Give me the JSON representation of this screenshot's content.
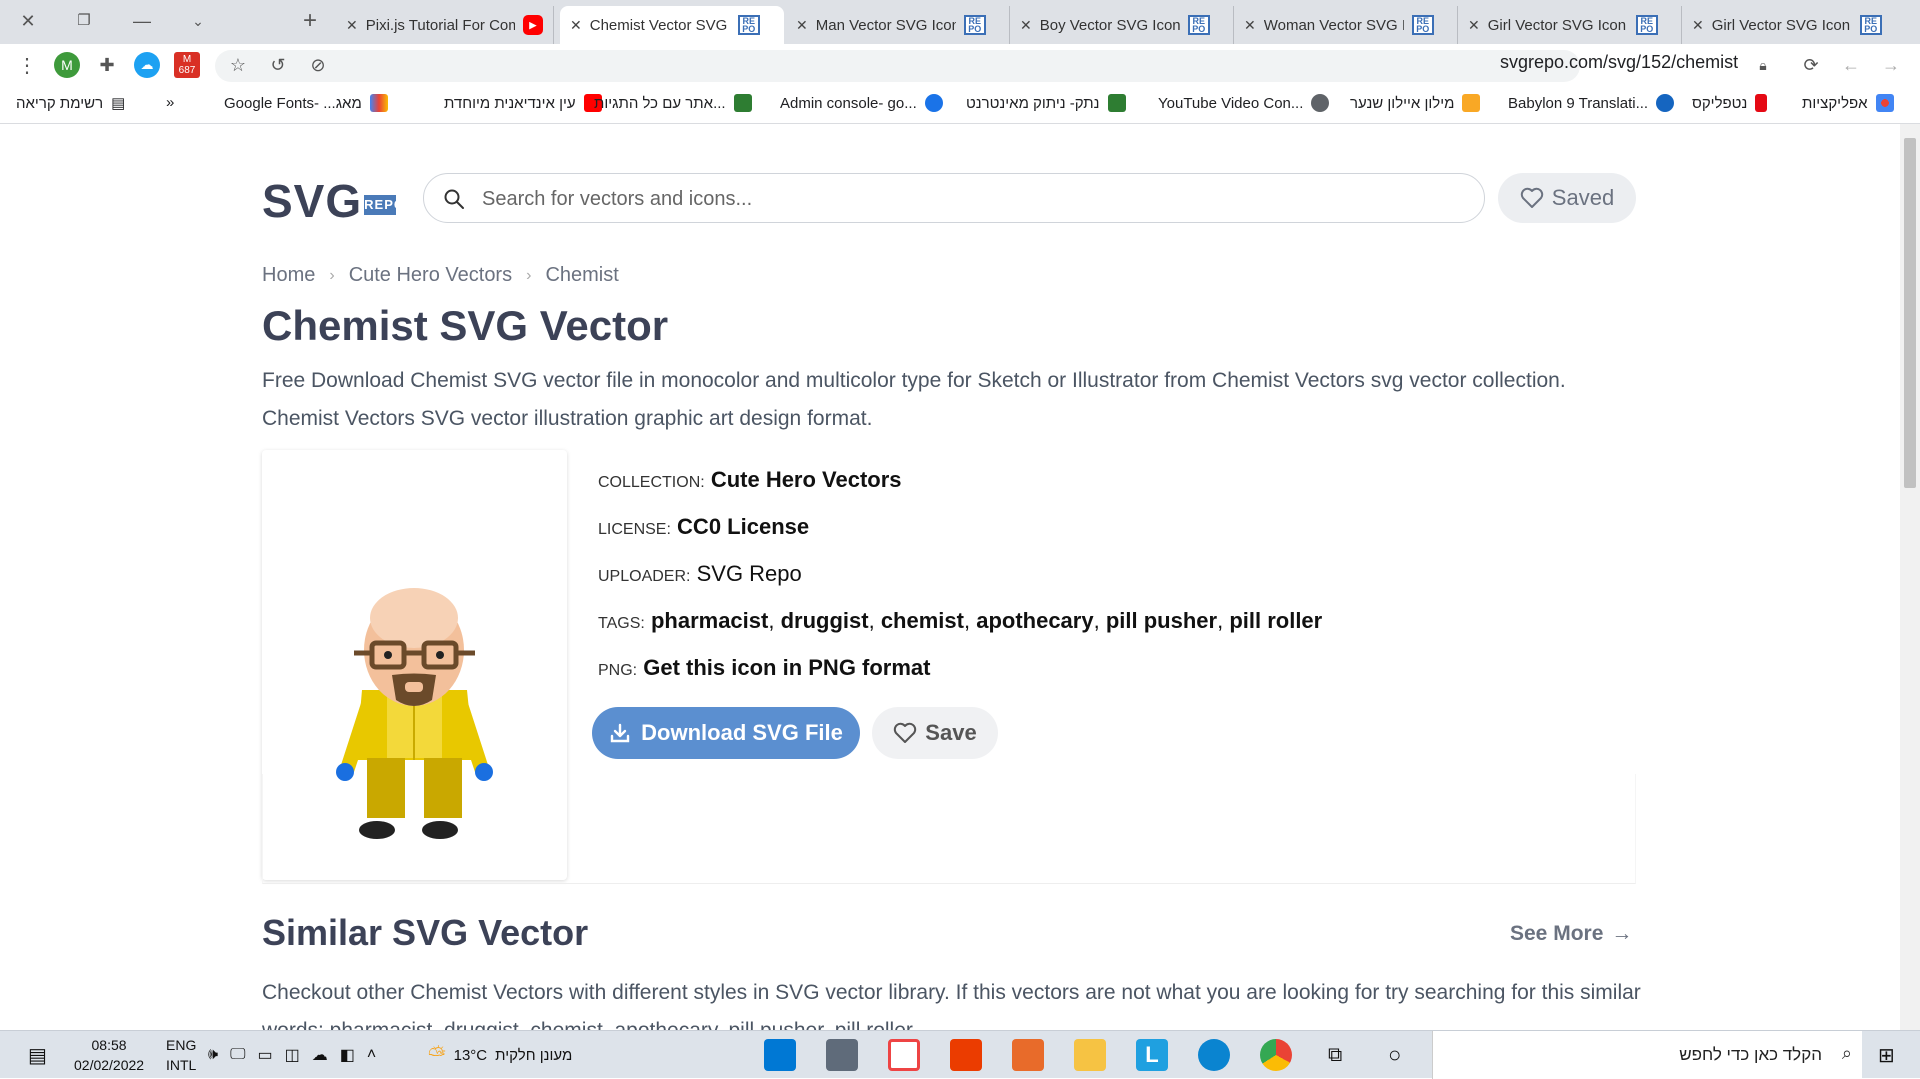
{
  "browser": {
    "tabs": [
      {
        "title": "Pixi.js Tutorial For Com",
        "favicon": "youtube-icon"
      },
      {
        "title": "Chemist Vector SVG Icon",
        "favicon": "svgrepo-icon",
        "active": true
      },
      {
        "title": "Man Vector SVG Icon",
        "favicon": "svgrepo-icon"
      },
      {
        "title": "Boy Vector SVG Icon (",
        "favicon": "svgrepo-icon"
      },
      {
        "title": "Woman Vector SVG Ic",
        "favicon": "svgrepo-icon"
      },
      {
        "title": "Girl Vector SVG Icon (",
        "favicon": "svgrepo-icon"
      },
      {
        "title": "Girl Vector SVG Icon (",
        "favicon": "svgrepo-icon"
      }
    ],
    "url": "svgrepo.com/svg/152/chemist",
    "gmail_badge": "687",
    "profile_initial": "M",
    "bookmarks": [
      {
        "label": "אפליקציות"
      },
      {
        "label": "נטפליקס"
      },
      {
        "label": "Babylon 9 Translati..."
      },
      {
        "label": "מילון איילון שנער"
      },
      {
        "label": "YouTube Video Con..."
      },
      {
        "label": "נתק- ניתוק מאינטרנט"
      },
      {
        "label": "Admin console- go..."
      },
      {
        "label": "אתר עם כל התגיות..."
      },
      {
        "label": "עין אינדיאנית מיוחדת"
      },
      {
        "label": "Google Fonts- ...מאג"
      }
    ],
    "bookmarks_more": "»",
    "reading_list": "רשימת קריאה"
  },
  "site": {
    "logo_text": "SVG",
    "logo_badge": "REPO",
    "search_placeholder": "Search for vectors and icons...",
    "saved_label": "Saved"
  },
  "breadcrumb": [
    "Home",
    "Cute Hero Vectors",
    "Chemist"
  ],
  "page": {
    "title": "Chemist SVG Vector",
    "description": "Free Download Chemist SVG vector file in monocolor and multicolor type for Sketch or Illustrator from Chemist Vectors svg vector collection. Chemist Vectors SVG vector illustration graphic art design format."
  },
  "meta": {
    "collection_key": "COLLECTION:",
    "collection_val": "Cute Hero Vectors",
    "license_key": "LICENSE:",
    "license_val": "CC0 License",
    "uploader_key": "UPLOADER:",
    "uploader_val": "SVG Repo",
    "tags_key": "TAGS:",
    "tags": [
      "pharmacist",
      "druggist",
      "chemist",
      "apothecary",
      "pill pusher",
      "pill roller"
    ],
    "png_key": "PNG:",
    "png_val": "Get this icon in PNG format"
  },
  "actions": {
    "download_label": "Download SVG File",
    "save_label": "Save"
  },
  "similar": {
    "title": "Similar SVG Vector",
    "see_more": "See More",
    "description": "Checkout other Chemist Vectors with different styles in SVG vector library. If this vectors are not what you are looking for try searching for this similar words: pharmacist, druggist, chemist, apothecary, pill pusher, pill roller"
  },
  "taskbar": {
    "search_placeholder": "הקלד כאן כדי לחפש",
    "weather_text": "מעונן חלקית",
    "temperature": "13°C",
    "lang1": "ENG",
    "lang2": "INTL",
    "time": "08:58",
    "date": "02/02/2022"
  },
  "colors": {
    "accent": "#5b8fd0",
    "logo": "#3c4257",
    "tabstrip": "#dee1e6"
  }
}
